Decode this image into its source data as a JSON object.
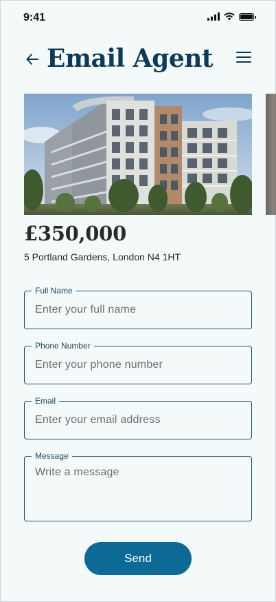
{
  "status_bar": {
    "time": "9:41"
  },
  "header": {
    "title": "Email Agent",
    "back_icon": "arrow-left-icon",
    "menu_icon": "hamburger-menu-icon"
  },
  "listing": {
    "price": "£350,000",
    "address": "5 Portland Gardens, London N4 1HT"
  },
  "form": {
    "full_name": {
      "label": "Full Name",
      "placeholder": "Enter your full name",
      "value": ""
    },
    "phone": {
      "label": "Phone Number",
      "placeholder": "Enter your phone number",
      "value": ""
    },
    "email": {
      "label": "Email",
      "placeholder": "Enter your email address",
      "value": ""
    },
    "message": {
      "label": "Message",
      "placeholder": "Write a message",
      "value": ""
    },
    "send_label": "Send"
  },
  "colors": {
    "background": "#f4f9f9",
    "title": "#0f3a57",
    "field_border": "#1d4a6a",
    "button": "#0d6a96"
  }
}
